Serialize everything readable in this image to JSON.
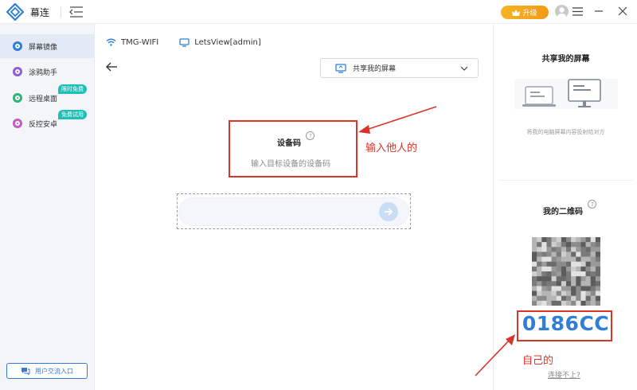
{
  "titlebar": {
    "app_name": "幕连",
    "upgrade_label": "升级"
  },
  "sidebar": {
    "items": [
      {
        "label": "屏幕镜像",
        "icon": "mirror-icon",
        "active": true
      },
      {
        "label": "涂鸦助手",
        "icon": "doodle-icon"
      },
      {
        "label": "远程桌面",
        "icon": "remote-desktop-icon",
        "badge": "限时免费"
      },
      {
        "label": "反控安卓",
        "icon": "android-control-icon",
        "badge": "免费试用"
      }
    ],
    "feedback_label": "用户交流入口"
  },
  "main": {
    "wifi_name": "TMG-WIFI",
    "device_name": "LetsView[admin]",
    "share_select_label": "共享我的屏幕",
    "code_title": "设备码",
    "code_placeholder": "输入目标设备的设备码",
    "annotation": "输入他人的"
  },
  "right_panel": {
    "share_heading": "共享我的屏幕",
    "share_desc": "将我的电脑屏幕内容投射给对方",
    "qr_heading": "我的二维码",
    "my_code": "0186CC",
    "annotation": "自己的",
    "cant_connect": "连接不上?"
  },
  "colors": {
    "accent": "#2f7fd6",
    "annotation_red": "#d8352a",
    "upgrade": "#f19a14",
    "badge": "#1fbfb8"
  }
}
